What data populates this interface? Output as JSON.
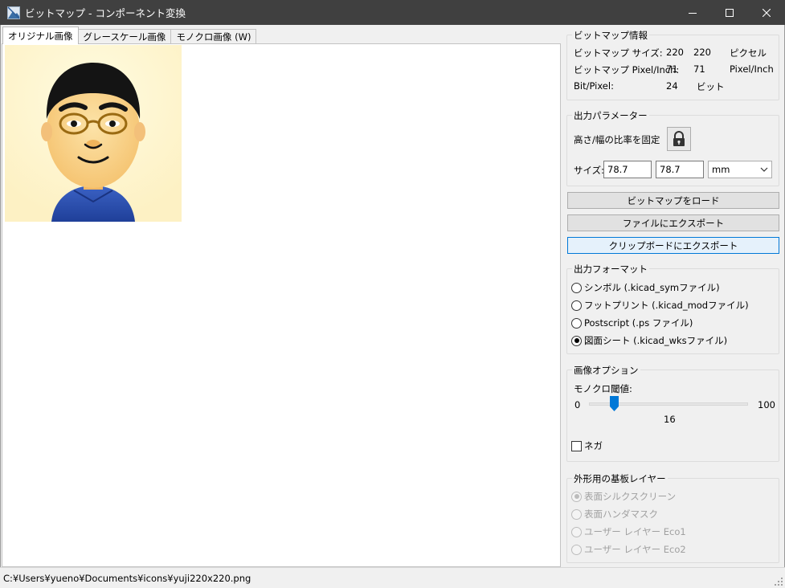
{
  "window": {
    "title": "ビットマップ - コンポーネント変換"
  },
  "tabs": [
    {
      "label": "オリジナル画像",
      "active": true
    },
    {
      "label": "グレースケール画像",
      "active": false
    },
    {
      "label": "モノクロ画像 (W)",
      "active": false
    }
  ],
  "bitmap_info": {
    "title": "ビットマップ情報",
    "size_label": "ビットマップ サイズ:",
    "size_w": "220",
    "size_h": "220",
    "size_unit": "ピクセル",
    "ppi_label": "ビットマップ Pixel/Inch:",
    "ppi_w": "71",
    "ppi_h": "71",
    "ppi_unit": "Pixel/Inch",
    "bpp_label": "Bit/Pixel:",
    "bpp_value": "24",
    "bpp_unit": "ビット"
  },
  "output_params": {
    "title": "出力パラメーター",
    "lock_label": "高さ/幅の比率を固定",
    "size_label": "サイズ:",
    "width_value": "78.7",
    "height_value": "78.7",
    "unit_selected": "mm"
  },
  "buttons": {
    "load": "ビットマップをロード",
    "export_file": "ファイルにエクスポート",
    "export_clipboard": "クリップボードにエクスポート"
  },
  "output_format": {
    "title": "出力フォーマット",
    "options": [
      {
        "label": "シンボル (.kicad_symファイル)",
        "checked": false
      },
      {
        "label": "フットプリント (.kicad_modファイル)",
        "checked": false
      },
      {
        "label": "Postscript (.ps ファイル)",
        "checked": false
      },
      {
        "label": "図面シート (.kicad_wksファイル)",
        "checked": true
      }
    ]
  },
  "image_options": {
    "title": "画像オプション",
    "threshold_label": "モノクロ閾値:",
    "slider_min": "0",
    "slider_max": "100",
    "slider_value": "16",
    "negative_label": "ネガ",
    "negative_checked": false
  },
  "board_layer": {
    "title": "外形用の基板レイヤー",
    "options": [
      {
        "label": "表面シルクスクリーン",
        "checked": true
      },
      {
        "label": "表面ハンダマスク",
        "checked": false
      },
      {
        "label": "ユーザー レイヤー Eco1",
        "checked": false
      },
      {
        "label": "ユーザー レイヤー Eco2",
        "checked": false
      }
    ]
  },
  "status": {
    "path": "C:¥Users¥yueno¥Documents¥icons¥yuji220x220.png"
  },
  "colors": {
    "titlebar": "#404040",
    "accent": "#0078d7"
  }
}
